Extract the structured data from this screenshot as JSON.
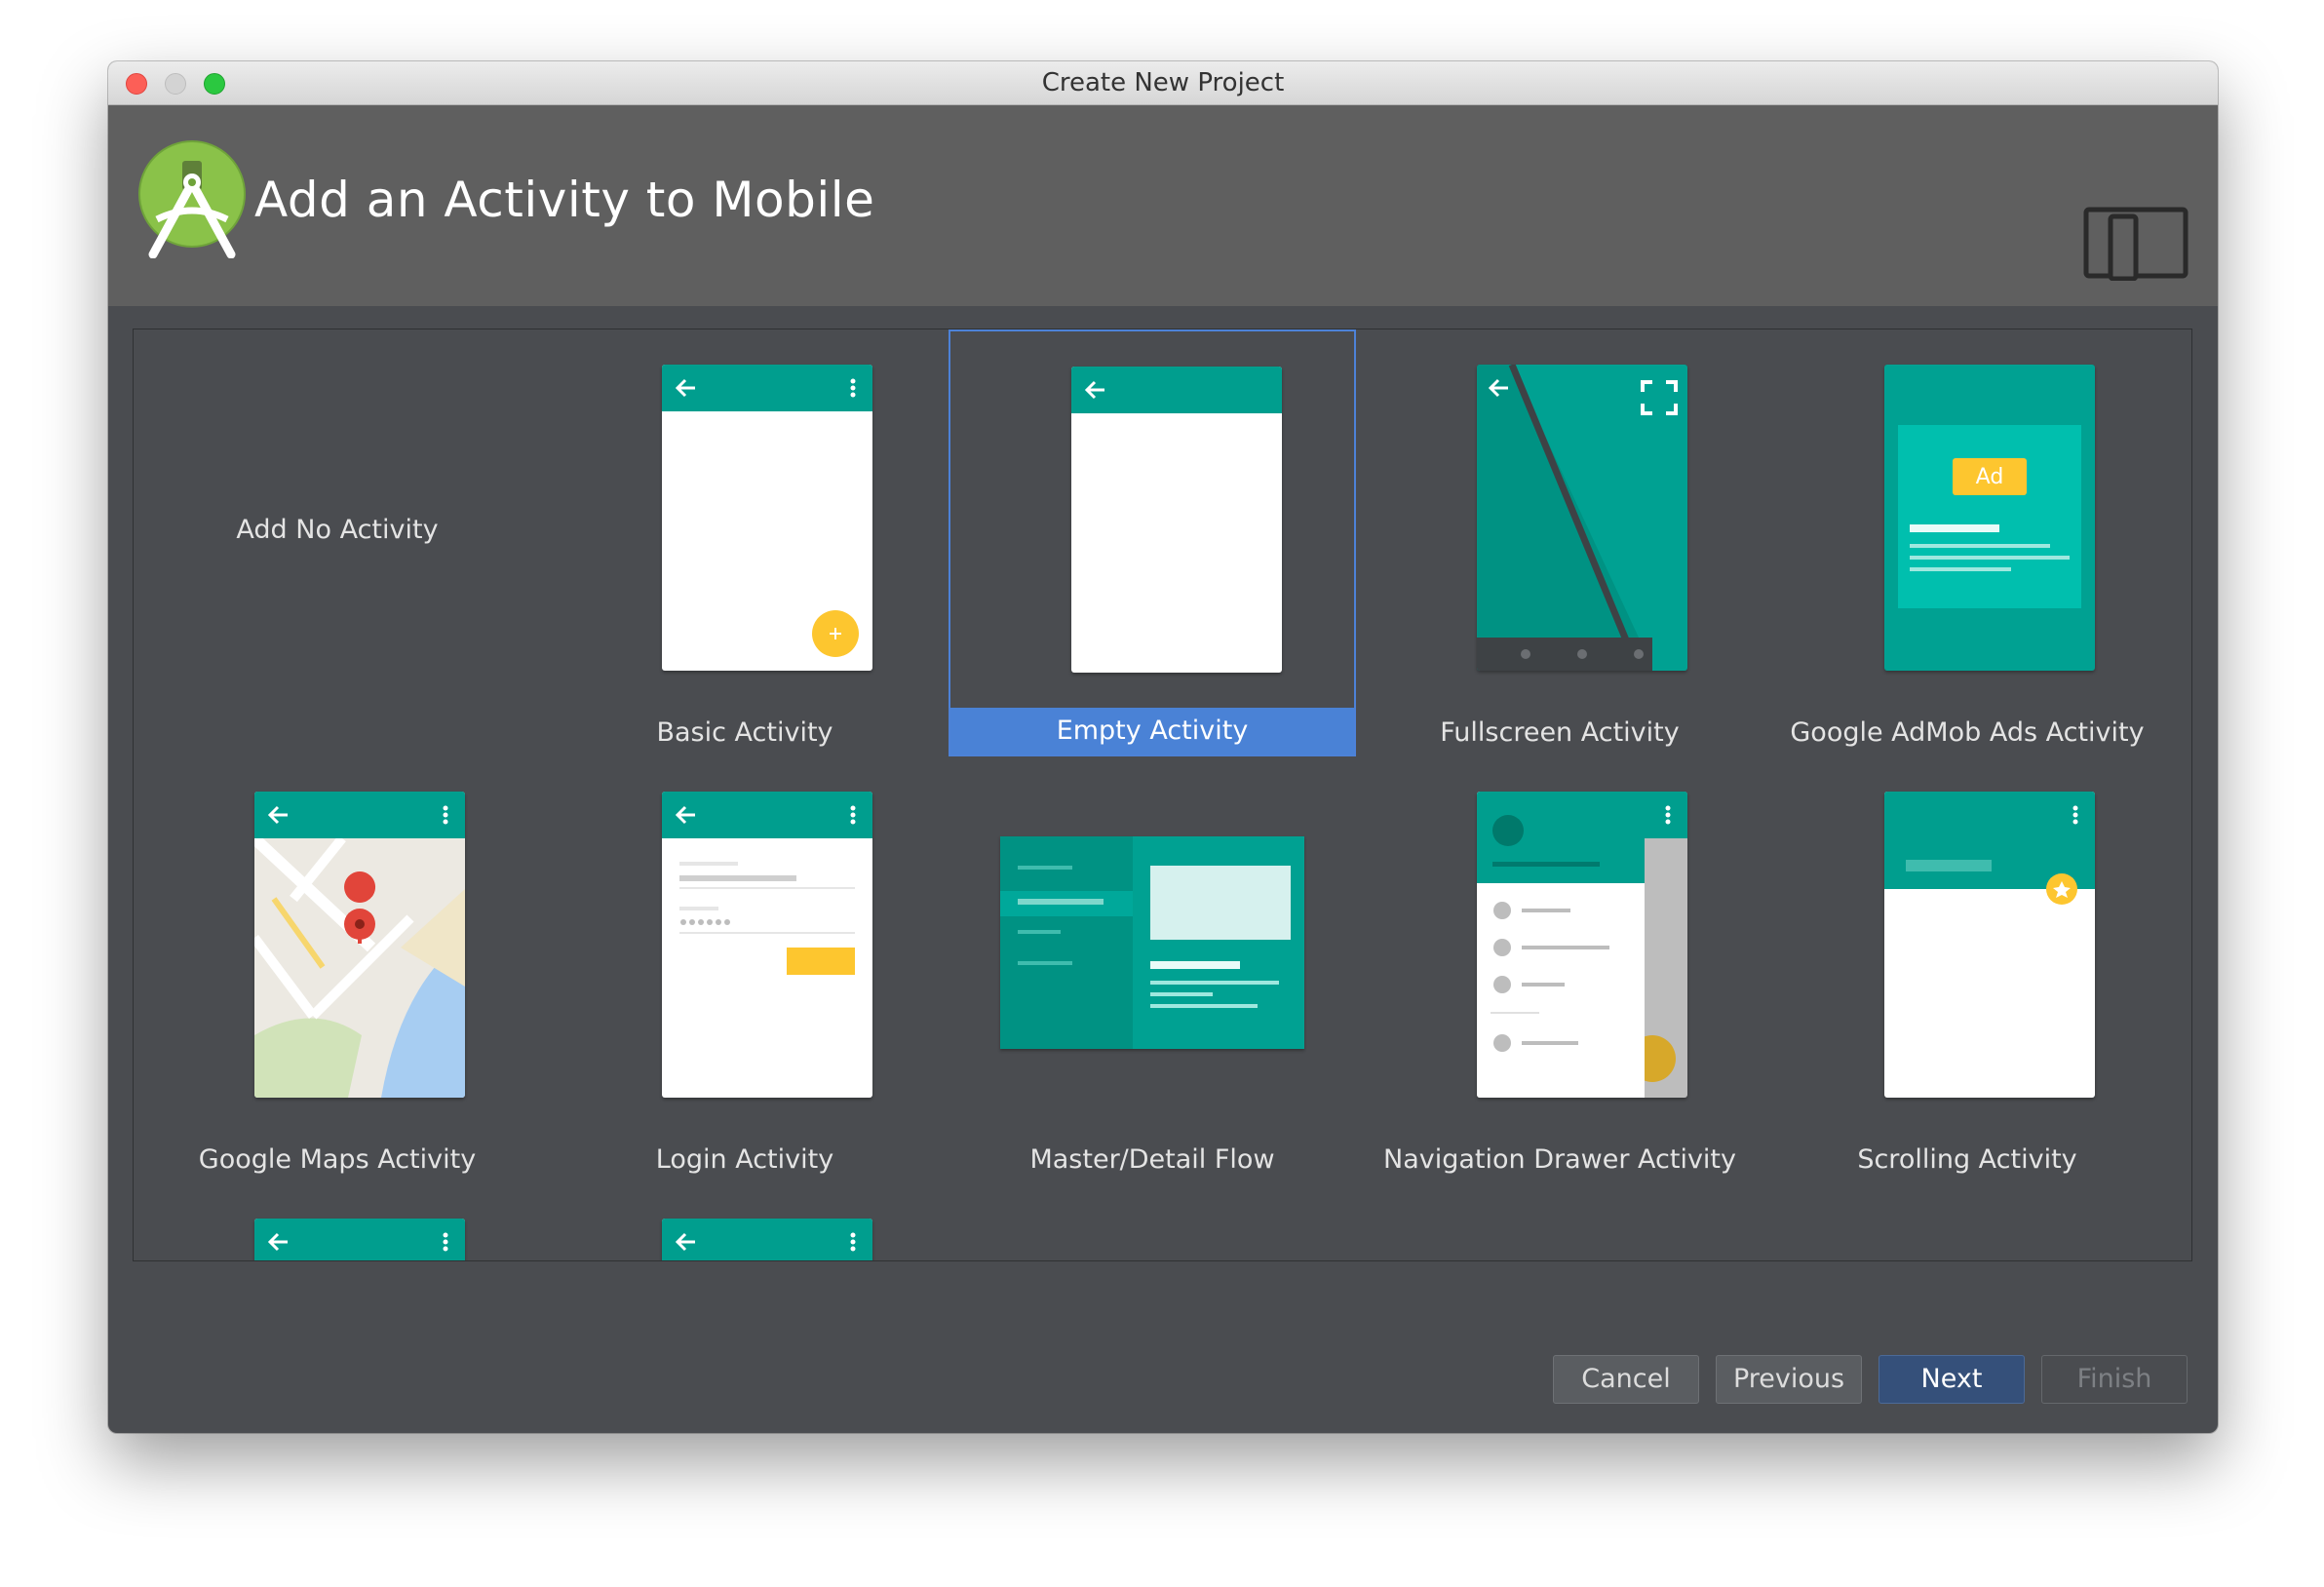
{
  "window": {
    "title": "Create New Project"
  },
  "header": {
    "title": "Add an Activity to Mobile",
    "logo_icon": "android-studio-logo-icon",
    "device_icon": "phone-tablet-icon"
  },
  "colors": {
    "teal": "#009e8e",
    "teal_light": "#00b8a5",
    "selection": "#4a82d6",
    "accent_yellow": "#fdc62f"
  },
  "gallery": {
    "selected": "Empty Activity",
    "tiles": [
      {
        "label": "Add No Activity"
      },
      {
        "label": "Basic Activity"
      },
      {
        "label": "Empty Activity"
      },
      {
        "label": "Fullscreen Activity"
      },
      {
        "label": "Google AdMob Ads Activity",
        "badge": "Ad"
      },
      {
        "label": "Google Maps Activity"
      },
      {
        "label": "Login Activity"
      },
      {
        "label": "Master/Detail Flow"
      },
      {
        "label": "Navigation Drawer Activity"
      },
      {
        "label": "Scrolling Activity"
      }
    ]
  },
  "buttons": {
    "cancel": "Cancel",
    "previous": "Previous",
    "next": "Next",
    "finish": "Finish"
  }
}
